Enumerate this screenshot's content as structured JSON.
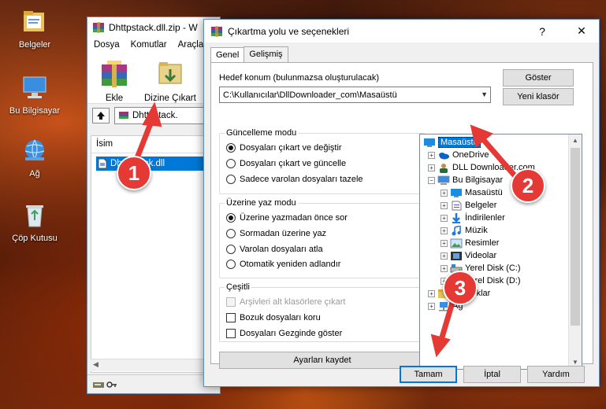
{
  "desktop": {
    "icons": [
      {
        "label": "Belgeler"
      },
      {
        "label": "Bu Bilgisayar"
      },
      {
        "label": "Ağ"
      },
      {
        "label": "Çöp Kutusu"
      }
    ]
  },
  "winrar": {
    "title": "Dhttpstack.dll.zip - W",
    "menu": [
      "Dosya",
      "Komutlar",
      "Araçla"
    ],
    "toolbar": {
      "add_label": "Ekle",
      "extract_label": "Dizine Çıkart"
    },
    "path": "Dhttpstack.",
    "list": {
      "column_name": "İsim",
      "file": "Dhttpstack.dll"
    }
  },
  "dialog": {
    "title": "Çıkartma yolu ve seçenekleri",
    "help_glyph": "?",
    "close_glyph": "✕",
    "tabs": [
      "Genel",
      "Gelişmiş"
    ],
    "dest_label": "Hedef konum (bulunmazsa oluşturulacak)",
    "dest_value": "C:\\Kullanıcılar\\DllDownloader_com\\Masaüstü",
    "show_button": "Göster",
    "new_folder_button": "Yeni klasör",
    "update_mode": {
      "title": "Güncelleme modu",
      "options": [
        {
          "label": "Dosyaları çıkart ve değiştir",
          "selected": true
        },
        {
          "label": "Dosyaları çıkart ve güncelle",
          "selected": false
        },
        {
          "label": "Sadece varolan dosyaları tazele",
          "selected": false
        }
      ]
    },
    "overwrite_mode": {
      "title": "Üzerine yaz modu",
      "options": [
        {
          "label": "Üzerine yazmadan önce sor",
          "selected": true
        },
        {
          "label": "Sormadan üzerine yaz",
          "selected": false
        },
        {
          "label": "Varolan dosyaları atla",
          "selected": false
        },
        {
          "label": "Otomatik yeniden adlandır",
          "selected": false
        }
      ]
    },
    "misc": {
      "title": "Çeşitli",
      "options": [
        {
          "label": "Arşivleri alt klasörlere çıkart",
          "checked": false,
          "disabled": true
        },
        {
          "label": "Bozuk dosyaları koru",
          "checked": false,
          "disabled": false
        },
        {
          "label": "Dosyaları Gezginde göster",
          "checked": false,
          "disabled": false
        }
      ]
    },
    "save_settings_button": "Ayarları kaydet",
    "tree": [
      {
        "label": "Masaüstü",
        "icon": "desktop-icon"
      },
      {
        "label": "OneDrive",
        "icon": "onedrive-icon"
      },
      {
        "label": "DLL Downloader.com",
        "icon": "user-icon"
      },
      {
        "label": "Bu Bilgisayar",
        "icon": "computer-icon"
      },
      {
        "label": "Masaüstü",
        "icon": "desktop-icon"
      },
      {
        "label": "Belgeler",
        "icon": "documents-icon"
      },
      {
        "label": "İndirilenler",
        "icon": "downloads-icon"
      },
      {
        "label": "Müzik",
        "icon": "music-icon"
      },
      {
        "label": "Resimler",
        "icon": "pictures-icon"
      },
      {
        "label": "Videolar",
        "icon": "videos-icon"
      },
      {
        "label": "Yerel Disk (C:)",
        "icon": "drive-icon"
      },
      {
        "label": "Yerel Disk (D:)",
        "icon": "drive-icon"
      },
      {
        "label": "Kitaplıklar",
        "icon": "libraries-icon"
      },
      {
        "label": "Ağ",
        "icon": "network-icon"
      }
    ],
    "ok_button": "Tamam",
    "cancel_button": "İptal",
    "help_button": "Yardım"
  },
  "annotations": [
    "1",
    "2",
    "3"
  ],
  "colors": {
    "selection": "#0078d7",
    "badge": "#e53935"
  }
}
